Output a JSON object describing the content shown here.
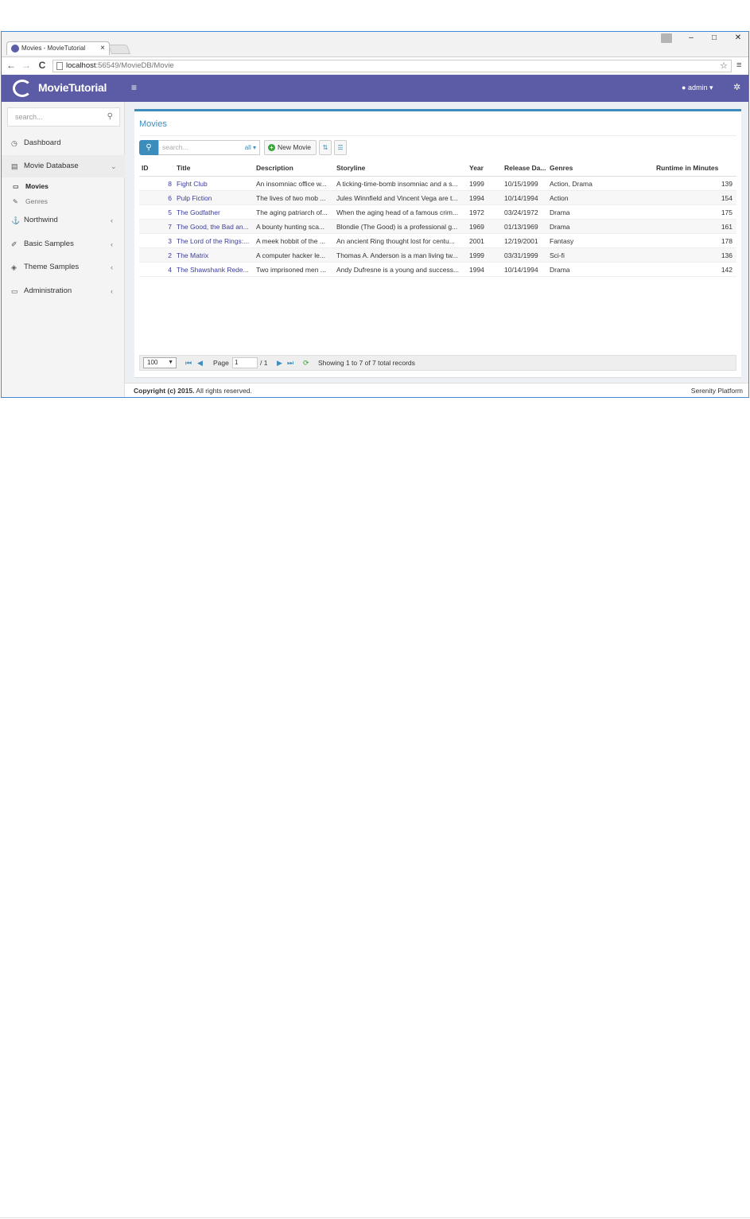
{
  "browser": {
    "tab_title": "Movies - MovieTutorial",
    "tab_close": "×",
    "window_controls": {
      "minimize": "–",
      "maximize": "□",
      "close": "✕"
    },
    "nav": {
      "back": "←",
      "forward": "→",
      "reload": "C"
    },
    "url_host": "localhost",
    "url_rest": ":56549/MovieDB/Movie"
  },
  "app": {
    "brand": "MovieTutorial",
    "user": "admin",
    "hamburger": "≡"
  },
  "sidebar": {
    "search_placeholder": "search...",
    "items": [
      {
        "label": "Dashboard",
        "icon": "tachometer-icon"
      },
      {
        "label": "Movie Database",
        "icon": "film-icon"
      },
      {
        "label": "Northwind",
        "icon": "anchor-icon"
      },
      {
        "label": "Basic Samples",
        "icon": "magic-icon"
      },
      {
        "label": "Theme Samples",
        "icon": "diamond-icon"
      },
      {
        "label": "Administration",
        "icon": "desktop-icon"
      }
    ],
    "sub_items": [
      {
        "label": "Movies",
        "active": true
      },
      {
        "label": "Genres",
        "active": false
      }
    ]
  },
  "panel": {
    "title": "Movies",
    "search_placeholder": "search...",
    "search_field": "all",
    "new_button": "New Movie"
  },
  "grid": {
    "columns": [
      "ID",
      "Title",
      "Description",
      "Storyline",
      "Year",
      "Release Da...",
      "Genres",
      "Runtime in Minutes"
    ],
    "rows": [
      {
        "id": "8",
        "title": "Fight Club",
        "description": "An insomniac office w...",
        "storyline": "A ticking-time-bomb insomniac and a s...",
        "year": "1999",
        "release": "10/15/1999",
        "genres": "Action, Drama",
        "runtime": "139"
      },
      {
        "id": "6",
        "title": "Pulp Fiction",
        "description": "The lives of two mob ...",
        "storyline": "Jules Winnfield and Vincent Vega are t...",
        "year": "1994",
        "release": "10/14/1994",
        "genres": "Action",
        "runtime": "154"
      },
      {
        "id": "5",
        "title": "The Godfather",
        "description": "The aging patriarch of...",
        "storyline": "When the aging head of a famous crim...",
        "year": "1972",
        "release": "03/24/1972",
        "genres": "Drama",
        "runtime": "175"
      },
      {
        "id": "7",
        "title": "The Good, the Bad an...",
        "description": "A bounty hunting sca...",
        "storyline": "Blondie (The Good) is a professional g...",
        "year": "1969",
        "release": "01/13/1969",
        "genres": "Drama",
        "runtime": "161"
      },
      {
        "id": "3",
        "title": "The Lord of the Rings:...",
        "description": "A meek hobbit of the ...",
        "storyline": "An ancient Ring thought lost for centu...",
        "year": "2001",
        "release": "12/19/2001",
        "genres": "Fantasy",
        "runtime": "178"
      },
      {
        "id": "2",
        "title": "The Matrix",
        "description": "A computer hacker le...",
        "storyline": "Thomas A. Anderson is a man living tw...",
        "year": "1999",
        "release": "03/31/1999",
        "genres": "Sci-fi",
        "runtime": "136"
      },
      {
        "id": "4",
        "title": "The Shawshank Rede...",
        "description": "Two imprisoned men ...",
        "storyline": "Andy Dufresne is a young and success...",
        "year": "1994",
        "release": "10/14/1994",
        "genres": "Drama",
        "runtime": "142"
      }
    ]
  },
  "pager": {
    "page_size": "100",
    "page_label": "Page",
    "page_value": "1",
    "page_total": "/ 1",
    "status": "Showing 1 to 7 of 7 total records"
  },
  "footer": {
    "copyright_bold": "Copyright (c) 2015.",
    "copyright_rest": " All rights reserved.",
    "platform": "Serenity Platform"
  },
  "colors": {
    "header": "#5c5ca6",
    "accent": "#3c8dbc",
    "new_button_icon": "#39a339"
  }
}
